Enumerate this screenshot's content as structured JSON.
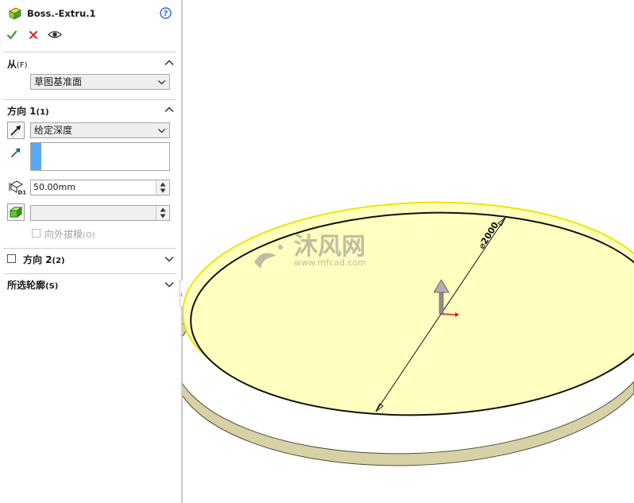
{
  "feature": {
    "title": "Boss.-Extru.1",
    "help_icon": "question-circle-icon",
    "icon": "boss-extrude-icon"
  },
  "actions": {
    "ok_icon": "checkmark-icon",
    "cancel_icon": "close-icon",
    "preview_icon": "eye-icon"
  },
  "from_section": {
    "title": "从",
    "mnemonic": "(F)",
    "selected": "草图基准面"
  },
  "direction1": {
    "title": "方向 1",
    "mnemonic": "(1)",
    "end_condition": "给定深度",
    "depth_value": "50.00mm",
    "draft_value": "",
    "draft_label": "向外拔模",
    "draft_mnemonic": "(O)",
    "draft_checked": false
  },
  "direction2": {
    "title": "方向 2",
    "mnemonic": "(2)",
    "checked": false
  },
  "contours_section": {
    "title": "所选轮廓",
    "mnemonic": "(S)"
  },
  "viewport": {
    "dimension_text": "⌀2000",
    "watermark_brand": "沐风网",
    "watermark_url": "www.mfcad.com",
    "face_color": "#ffffc0",
    "edge_highlight_color": "#f2e600"
  }
}
